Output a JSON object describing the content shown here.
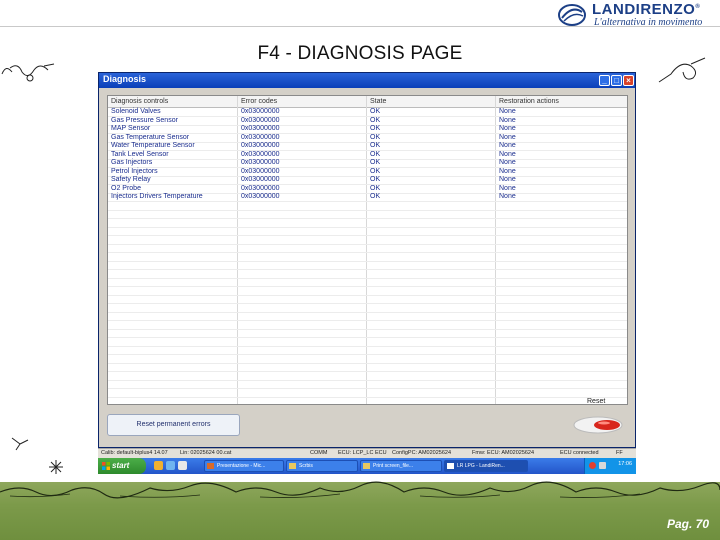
{
  "brand": {
    "name": "LANDIRENZO",
    "tagline": "L'alternativa in movimento",
    "registered_mark": "®"
  },
  "page_title": "F4 - DIAGNOSIS PAGE",
  "window": {
    "title": "Diagnosis",
    "controls": {
      "minimize": "_",
      "maximize": "□",
      "close": "×"
    }
  },
  "table": {
    "headers": {
      "controls": "Diagnosis controls",
      "codes": "Error codes",
      "state": "State",
      "actions": "Restoration actions"
    },
    "rows": [
      {
        "control": "Solenoid Valves",
        "code": "0x03000000",
        "state": "OK",
        "action": "None"
      },
      {
        "control": "Gas Pressure Sensor",
        "code": "0x03000000",
        "state": "OK",
        "action": "None"
      },
      {
        "control": "MAP Sensor",
        "code": "0x03000000",
        "state": "OK",
        "action": "None"
      },
      {
        "control": "Gas Temperature Sensor",
        "code": "0x03000000",
        "state": "OK",
        "action": "None"
      },
      {
        "control": "Water Temperature Sensor",
        "code": "0x03000000",
        "state": "OK",
        "action": "None"
      },
      {
        "control": "Tank Level Sensor",
        "code": "0x03000000",
        "state": "OK",
        "action": "None"
      },
      {
        "control": "Gas Injectors",
        "code": "0x03000000",
        "state": "OK",
        "action": "None"
      },
      {
        "control": "Petrol Injectors",
        "code": "0x03000000",
        "state": "OK",
        "action": "None"
      },
      {
        "control": "Safety Relay",
        "code": "0x03000000",
        "state": "OK",
        "action": "None"
      },
      {
        "control": "O2 Probe",
        "code": "0x03000000",
        "state": "OK",
        "action": "None"
      },
      {
        "control": "Injectors Drivers Temperature",
        "code": "0x03000000",
        "state": "OK",
        "action": "None"
      }
    ]
  },
  "buttons": {
    "reset_permanent": "Reset permanent errors",
    "reset_label": "Reset"
  },
  "status_bar": {
    "calib": "Calib: default-biplus4 14.07",
    "lin": "Lin: 02025624 00.cat",
    "comm": "COMM",
    "ecu": "ECU: LCP_LC ECU",
    "configpc": "ConfigPC: AM02025624",
    "fmw": "Fmw: ECU: AM02025624",
    "ecu_state": "ECU connected",
    "key": "FF"
  },
  "taskbar": {
    "start": "start",
    "tasks": [
      "Presentazione - Mic...",
      "Scrbis",
      "Print screen_file...",
      "LR LPG - LandiRen..."
    ],
    "clock": "17:06"
  },
  "footer": {
    "page": "Pag. 70"
  },
  "colors": {
    "brand_blue": "#1c3f86",
    "cell_text": "#1a2d8e",
    "title_bar": "#0a3fb8",
    "taskbar": "#2355c9",
    "start_green": "#3b9a39"
  }
}
